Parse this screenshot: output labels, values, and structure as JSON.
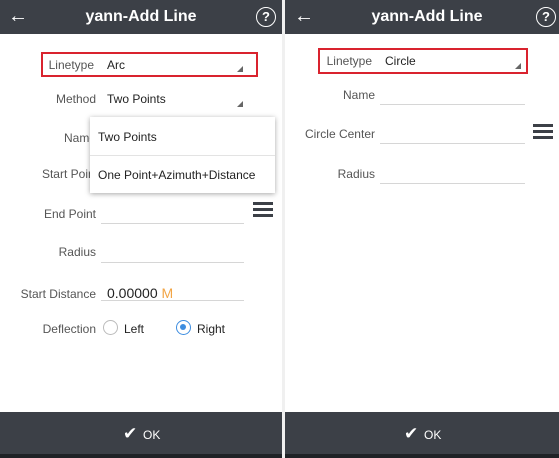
{
  "left": {
    "title": "yann-Add Line",
    "back_icon": "←",
    "help_icon": "?",
    "linetype_label": "Linetype",
    "linetype_value": "Arc",
    "method_label": "Method",
    "method_value": "Two Points",
    "name_label": "Name",
    "start_point_label": "Start Point",
    "end_point_label": "End Point",
    "radius_label": "Radius",
    "start_distance_label": "Start Distance",
    "start_distance_value": "0.00000",
    "start_distance_unit": "M",
    "deflection_label": "Deflection",
    "deflection_left": "Left",
    "deflection_right": "Right",
    "deflection_selected": "Right",
    "method_options": [
      "Two Points",
      "One Point+Azimuth+Distance"
    ],
    "ok_label": "OK"
  },
  "right": {
    "title": "yann-Add Line",
    "back_icon": "←",
    "help_icon": "?",
    "linetype_label": "Linetype",
    "linetype_value": "Circle",
    "name_label": "Name",
    "circle_center_label": "Circle Center",
    "radius_label": "Radius",
    "ok_label": "OK"
  },
  "icons": {
    "back": "back-arrow-icon",
    "help": "help-icon",
    "list": "point-list-icon",
    "check": "checkmark-icon",
    "dropdown": "dropdown-triangle-icon"
  },
  "colors": {
    "appbar": "#3c4047",
    "highlight_box": "#d9232e",
    "unit": "#f2a545",
    "radio_selected": "#3d8de0"
  }
}
